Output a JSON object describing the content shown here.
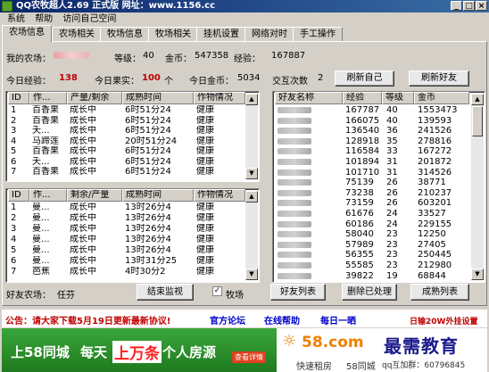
{
  "window": {
    "title": "QQ农牧超人2.69 正式版 网址：www.1156.cc",
    "min": "_",
    "max": "□",
    "close": "×"
  },
  "menu": [
    "系统",
    "帮助",
    "访问自己空间"
  ],
  "tabs": [
    "农场信息",
    "农场相关",
    "牧场信息",
    "牧场相关",
    "挂机设置",
    "网络对时",
    "手工操作"
  ],
  "farm": {
    "my_farm_label": "我的农场：",
    "level_label": "等级：",
    "level_value": "40",
    "gold_label": "金币：",
    "gold_value": "547358",
    "exp_label": "经验：",
    "exp_value": "167887",
    "today_exp_label": "今日经验：",
    "today_exp_value": "138",
    "today_fruit_label": "今日果实：",
    "today_fruit_value": "100",
    "today_fruit_unit": "个",
    "today_gold_label": "今日金币：",
    "today_gold_value": "5034",
    "interact_label": "交互次数",
    "interact_value": "2",
    "refresh_self": "刷新自己",
    "refresh_friends": "刷新好友"
  },
  "crop_table": {
    "headers": [
      "ID",
      "作...",
      "产量/剩余",
      "成熟时间",
      "作物情况"
    ],
    "rows": [
      [
        "1",
        "百香果",
        "成长中",
        "6时51分24",
        "健康"
      ],
      [
        "2",
        "百香果",
        "成长中",
        "6时51分24",
        "健康"
      ],
      [
        "3",
        "夭...",
        "成长中",
        "6时51分24",
        "健康"
      ],
      [
        "4",
        "马蹄莲",
        "成长中",
        "20时51分24",
        "健康"
      ],
      [
        "5",
        "百香果",
        "成长中",
        "6时51分24",
        "健康"
      ],
      [
        "6",
        "夭...",
        "成长中",
        "6时51分24",
        "健康"
      ],
      [
        "7",
        "百香果",
        "成长中",
        "6时51分24",
        "健康"
      ]
    ]
  },
  "friend_crop_table": {
    "headers": [
      "ID",
      "作...",
      "剩余/产量",
      "成熟时间",
      "作物情况"
    ],
    "rows": [
      [
        "1",
        "曼...",
        "成长中",
        "13时26分4",
        "健康"
      ],
      [
        "2",
        "曼...",
        "成长中",
        "13时26分4",
        "健康"
      ],
      [
        "3",
        "曼...",
        "成长中",
        "13时26分4",
        "健康"
      ],
      [
        "4",
        "曼...",
        "成长中",
        "13时26分4",
        "健康"
      ],
      [
        "5",
        "曼...",
        "成长中",
        "13时26分4",
        "健康"
      ],
      [
        "6",
        "曼...",
        "成长中",
        "13时31分25",
        "健康"
      ],
      [
        "7",
        "芭蕉",
        "成长中",
        "4时30分2",
        "健康"
      ]
    ]
  },
  "friend_table": {
    "headers": [
      "好友名称",
      "经验",
      "等级",
      "金币"
    ],
    "rows": [
      [
        "167787",
        "40",
        "1553473"
      ],
      [
        "166075",
        "40",
        "139593"
      ],
      [
        "136540",
        "36",
        "241526"
      ],
      [
        "128918",
        "35",
        "278816"
      ],
      [
        "116584",
        "33",
        "167272"
      ],
      [
        "101894",
        "31",
        "201872"
      ],
      [
        "101710",
        "31",
        "314526"
      ],
      [
        "75139",
        "26",
        "38771"
      ],
      [
        "73238",
        "26",
        "210237"
      ],
      [
        "73159",
        "26",
        "603201"
      ],
      [
        "61676",
        "24",
        "33527"
      ],
      [
        "60186",
        "24",
        "229155"
      ],
      [
        "58040",
        "23",
        "12250"
      ],
      [
        "57989",
        "23",
        "27405"
      ],
      [
        "56355",
        "23",
        "250445"
      ],
      [
        "55585",
        "23",
        "212980"
      ],
      [
        "39822",
        "19",
        "68844"
      ]
    ]
  },
  "bottom": {
    "friend_farm_label": "好友农场：",
    "friend_farm_value": "任芬",
    "end_monitor": "结束监视",
    "pasture_check": "牧场",
    "friend_list": "好友列表",
    "delete_processed": "删除已处理",
    "mature_list": "成熟列表"
  },
  "notice": {
    "text": "公告：请大家下载5月19日更新最新协议!",
    "forum": "官方论坛",
    "help": "在线帮助",
    "daily": "每日一晒",
    "plugin": "日输20W外挂设置"
  },
  "ad": {
    "left1": "上58同城",
    "left2": "每天",
    "left3": "上万条",
    "left4": "个人房源",
    "search": "查看详情",
    "brand": "58.com",
    "brand_prefix": "☼",
    "sub1": "快速租房",
    "sub2": "58同城",
    "qq": "qq互加群：60796845",
    "watermark": "最需教育"
  }
}
